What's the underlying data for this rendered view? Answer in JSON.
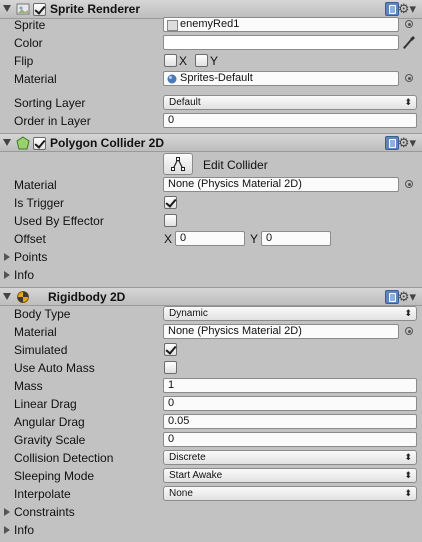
{
  "sprite_renderer": {
    "title": "Sprite Renderer",
    "enabled": true,
    "rows": {
      "sprite": {
        "label": "Sprite",
        "value": "enemyRed1"
      },
      "color": {
        "label": "Color",
        "value": "#ffffff"
      },
      "flip": {
        "label": "Flip",
        "x": "X",
        "y": "Y",
        "x_checked": false,
        "y_checked": false
      },
      "material": {
        "label": "Material",
        "value": "Sprites-Default"
      },
      "sorting_layer": {
        "label": "Sorting Layer",
        "value": "Default"
      },
      "order_in_layer": {
        "label": "Order in Layer",
        "value": "0"
      }
    }
  },
  "polygon_collider": {
    "title": "Polygon Collider 2D",
    "enabled": true,
    "edit_collider": "Edit Collider",
    "rows": {
      "material": {
        "label": "Material",
        "value": "None (Physics Material 2D)"
      },
      "is_trigger": {
        "label": "Is Trigger",
        "checked": true
      },
      "used_by_effector": {
        "label": "Used By Effector",
        "checked": false
      },
      "offset": {
        "label": "Offset",
        "x_label": "X",
        "x": "0",
        "y_label": "Y",
        "y": "0"
      },
      "points": {
        "label": "Points"
      },
      "info": {
        "label": "Info"
      }
    }
  },
  "rigidbody": {
    "title": "Rigidbody 2D",
    "rows": {
      "body_type": {
        "label": "Body Type",
        "value": "Dynamic"
      },
      "material": {
        "label": "Material",
        "value": "None (Physics Material 2D)"
      },
      "simulated": {
        "label": "Simulated",
        "checked": true
      },
      "use_auto_mass": {
        "label": "Use Auto Mass",
        "checked": false
      },
      "mass": {
        "label": "Mass",
        "value": "1"
      },
      "linear_drag": {
        "label": "Linear Drag",
        "value": "0"
      },
      "angular_drag": {
        "label": "Angular Drag",
        "value": "0.05"
      },
      "gravity_scale": {
        "label": "Gravity Scale",
        "value": "0"
      },
      "collision_detection": {
        "label": "Collision Detection",
        "value": "Discrete"
      },
      "sleeping_mode": {
        "label": "Sleeping Mode",
        "value": "Start Awake"
      },
      "interpolate": {
        "label": "Interpolate",
        "value": "None"
      },
      "constraints": {
        "label": "Constraints"
      },
      "info": {
        "label": "Info"
      }
    }
  },
  "icons": {
    "help": "help-book-icon",
    "settings": "gear-icon",
    "picker": "object-picker-icon",
    "eyedropper": "eyedropper-icon",
    "dropdown": "updown-arrows-icon"
  },
  "colors": {
    "panel_bg": "#c2c2c2",
    "header_bg": "#d0d0d0",
    "field_bg": "#fbfbfb",
    "accent_help": "#5d86bf"
  }
}
